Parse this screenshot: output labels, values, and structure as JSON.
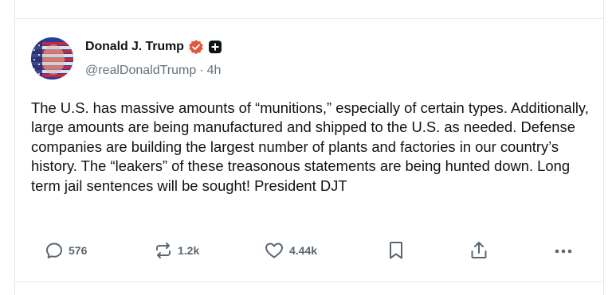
{
  "author": {
    "display_name": "Donald J. Trump",
    "handle": "@realDonaldTrump",
    "separator": "·",
    "time_ago": "4h",
    "verified_badge_color": "#e5573b"
  },
  "post": {
    "text": "The U.S. has massive amounts of “munitions,” especially of certain types. Additionally, large amounts are being manufactured and shipped to the U.S. as needed. Defense companies are building the largest number of plants and factories in our country’s history. The “leakers” of these treasonous statements are being hunted down. Long term jail sentences will be sought! President DJT"
  },
  "actions": {
    "reply_count": "576",
    "repost_count": "1.2k",
    "like_count": "4.44k",
    "icons": [
      "reply-icon",
      "repost-icon",
      "like-icon",
      "bookmark-icon",
      "share-icon",
      "more-icon"
    ]
  },
  "colors": {
    "text": "#0f1419",
    "secondary_text": "#65707b",
    "action_gray": "#5b6670",
    "divider": "#e6e8eb"
  }
}
